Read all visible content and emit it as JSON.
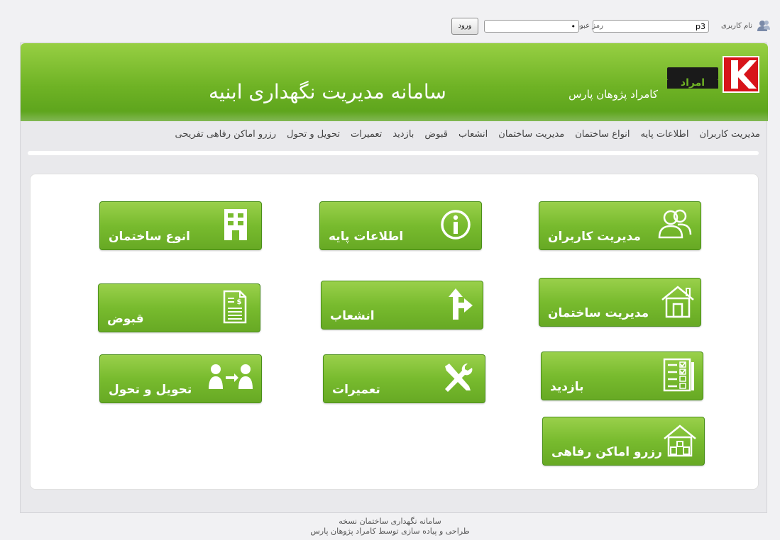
{
  "login": {
    "user_label": "نام کاربری",
    "user_value": "p3",
    "pass_label": "رمز عبور",
    "pass_value": "•",
    "login_button": "ورود"
  },
  "header": {
    "system_title": "سامانه  مدیریت نگهداری ابنیه",
    "company_name": "کامراد پژوهان پارس",
    "logo_text": "امراد"
  },
  "nav": {
    "items": [
      "مدیریت کاربران",
      "اطلاعات پایه",
      "انواع ساختمان",
      "مدیریت ساختمان",
      "انشعاب",
      "قبوض",
      "بازدید",
      "تعمیرات",
      "تحویل و تحول",
      "رزرو اماکن رفاهی تفریحی"
    ]
  },
  "tiles": {
    "users": "مدیریت کاربران",
    "base_info": "اطلاعات پایه",
    "building_types": "انوع ساختمان",
    "building_mgmt": "مدیریت ساختمان",
    "branch": "انشعاب",
    "bills": "قبوض",
    "visit": "بازدید",
    "repairs": "تعمیرات",
    "handover": "تحویل و تحول",
    "reservation": "رزرو اماکن رفاهی"
  },
  "footer": {
    "line1": "سامانه نگهداری ساختمان نسخه",
    "line2": "طراحی و پیاده سازی توسط کامراد پژوهان پارس"
  },
  "colors": {
    "banner_green": "#6fb325",
    "tile_green": "#78bb2e",
    "logo_red": "#d7141a"
  }
}
